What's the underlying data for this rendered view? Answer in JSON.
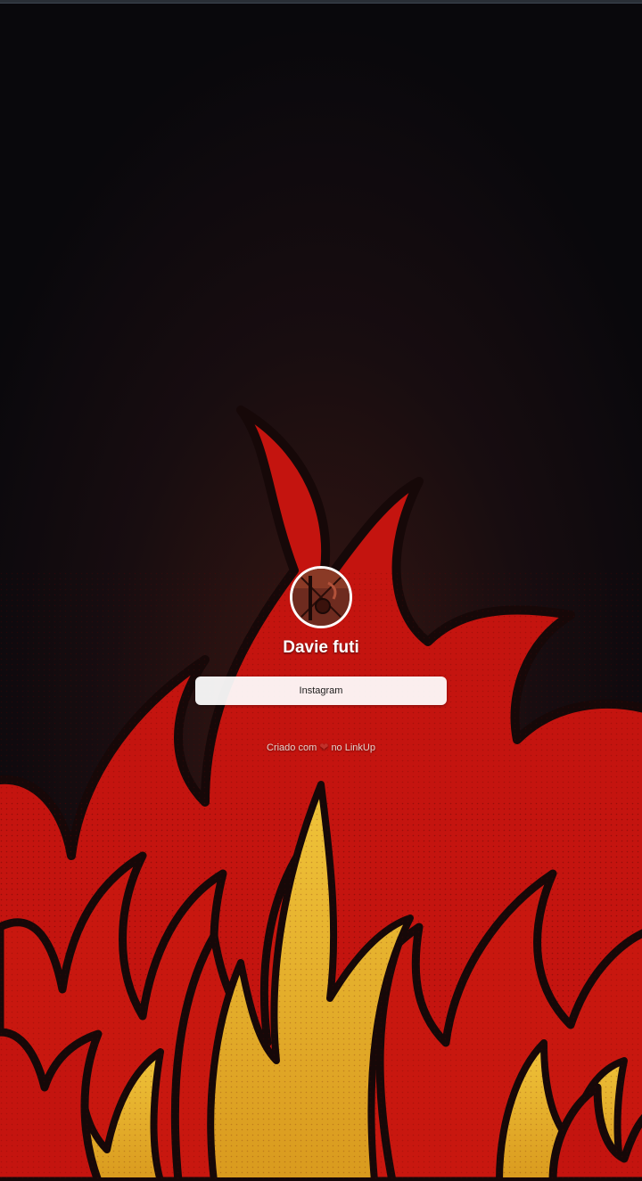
{
  "profile": {
    "name": "Davie futi",
    "links": [
      {
        "label": "Instagram"
      }
    ]
  },
  "footer": {
    "prefix": "Criado com",
    "heart_icon": "heart-icon",
    "suffix": "no LinkUp"
  },
  "colors": {
    "background_dark": "#0b0a0e",
    "flame_red": "#c4140f",
    "flame_yellow": "#e3b22a",
    "flame_outline": "#160808",
    "button_bg": "#f4f2f2"
  }
}
